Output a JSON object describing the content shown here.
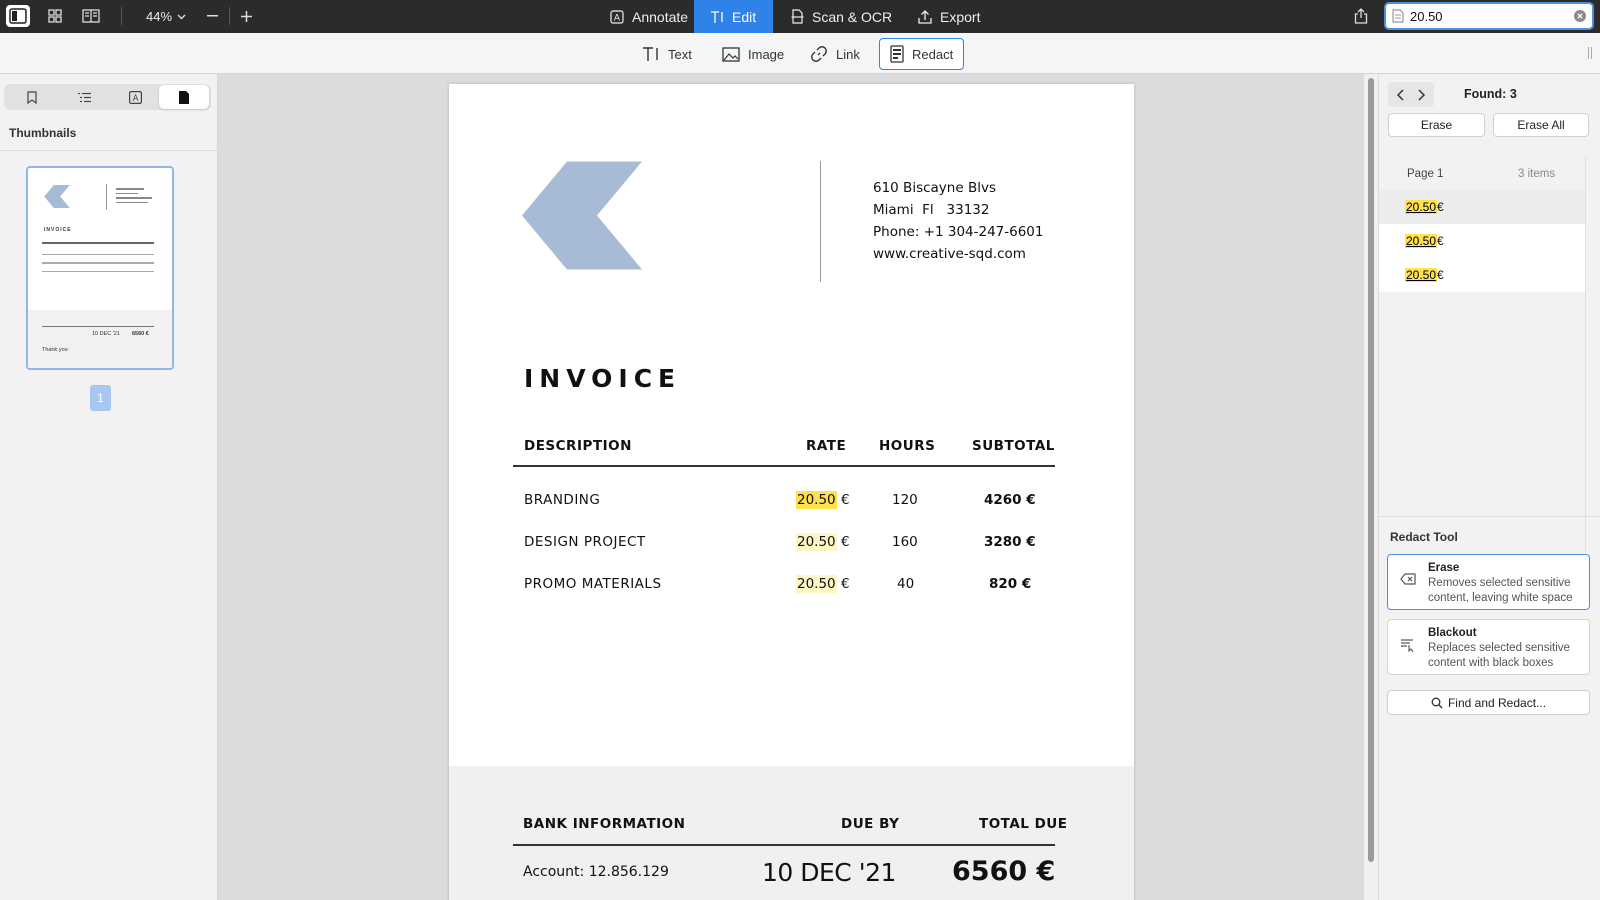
{
  "topbar": {
    "zoom": "44%",
    "tabs": [
      {
        "label": "Annotate",
        "icon": "annotate-icon"
      },
      {
        "label": "Edit",
        "icon": "edit-text-icon"
      },
      {
        "label": "Scan & OCR",
        "icon": "scan-icon"
      },
      {
        "label": "Export",
        "icon": "export-icon"
      }
    ],
    "search_value": "20.50"
  },
  "toolbar": {
    "tools": [
      {
        "label": "Text",
        "icon": "text-tool-icon"
      },
      {
        "label": "Image",
        "icon": "image-icon"
      },
      {
        "label": "Link",
        "icon": "link-icon"
      },
      {
        "label": "Redact",
        "icon": "redact-icon"
      }
    ]
  },
  "sidebar": {
    "title": "Thumbnails",
    "page_number": "1",
    "thumb": {
      "invoice": "INVOICE",
      "date": "10 DEC '21",
      "total": "6560 €",
      "thanks": "Thank you"
    }
  },
  "results": {
    "found": "Found: 3",
    "erase_label": "Erase",
    "erase_all_label": "Erase All",
    "page_label": "Page 1",
    "count_label": "3 items",
    "items": [
      {
        "match": "20.50",
        "rest": " €"
      },
      {
        "match": "20.50",
        "rest": " €"
      },
      {
        "match": "20.50",
        "rest": " €"
      }
    ]
  },
  "redact_tool": {
    "title": "Redact Tool",
    "options": [
      {
        "title": "Erase",
        "desc": "Removes selected sensitive content, leaving white space"
      },
      {
        "title": "Blackout",
        "desc": "Replaces selected sensitive content with black boxes"
      }
    ],
    "find_label": "Find and Redact..."
  },
  "invoice": {
    "address": [
      "610 Biscayne Blvs",
      "Miami  Fl   33132",
      "Phone: +1 304-247-6601",
      "www.creative-sqd.com"
    ],
    "title": "INVOICE",
    "headers": {
      "description": "DESCRIPTION",
      "rate": "RATE",
      "hours": "HOURS",
      "subtotal": "SUBTOTAL"
    },
    "rows": [
      {
        "description": "BRANDING",
        "rate": "20.50",
        "currency": "€",
        "hours": "120",
        "subtotal": "4260 €"
      },
      {
        "description": "DESIGN PROJECT",
        "rate": "20.50",
        "currency": "€",
        "hours": "160",
        "subtotal": "3280 €"
      },
      {
        "description": "PROMO MATERIALS",
        "rate": "20.50",
        "currency": "€",
        "hours": "40",
        "subtotal": "820 €"
      }
    ],
    "footer_headers": {
      "bank": "BANK INFORMATION",
      "due": "DUE BY",
      "total": "TOTAL DUE"
    },
    "account": "Account: 12.856.129",
    "due_date": "10 DEC '21",
    "total_due": "6560 €"
  },
  "colors": {
    "accent": "#2f82e8",
    "highlight": "#ffe04d",
    "logo": "#a7bbd7"
  }
}
